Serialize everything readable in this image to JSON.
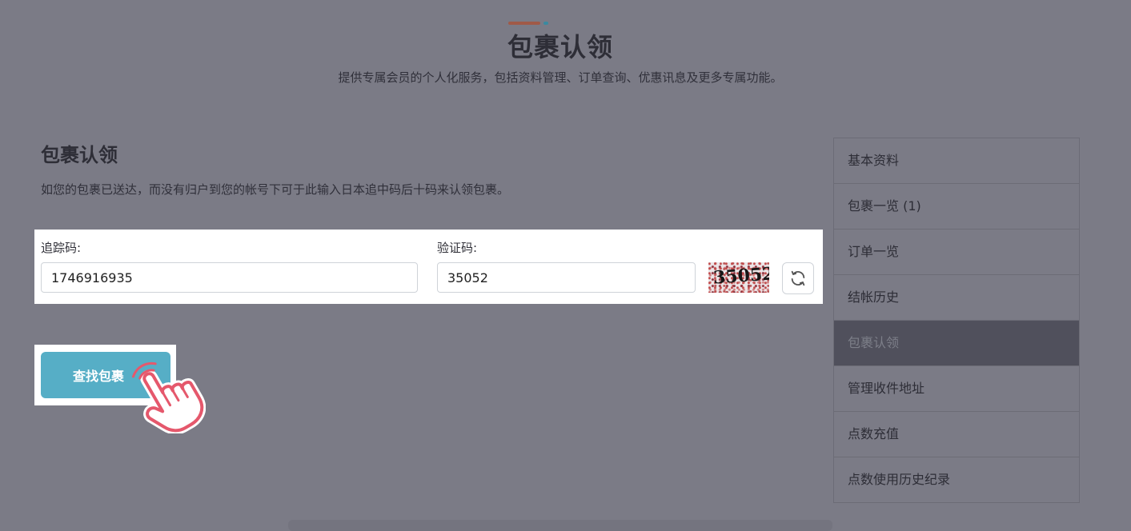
{
  "header": {
    "title": "包裹认领",
    "subtitle": "提供专属会员的个人化服务，包括资料管理、订单查询、优惠讯息及更多专属功能。",
    "accent_colors": [
      "#a05a48",
      "#3b8aa0"
    ]
  },
  "main": {
    "section_title": "包裹认领",
    "description": "如您的包裹已送达，而没有归户到您的帐号下可于此输入日本追中码后十码来认领包裹。",
    "form": {
      "tracking_label": "追踪码:",
      "tracking_value": "1746916935",
      "captcha_label": "验证码:",
      "captcha_value": "35052",
      "captcha_image_text": "35052",
      "refresh_icon": "refresh-icon"
    },
    "search_button_label": "查找包裹",
    "button_color": "#56aec6",
    "pointer_icon": "hand-pointer-icon"
  },
  "sidebar": {
    "items": [
      {
        "label": "基本资料",
        "active": false
      },
      {
        "label": "包裹一览 (1)",
        "active": false
      },
      {
        "label": "订单一览",
        "active": false
      },
      {
        "label": "结帐历史",
        "active": false
      },
      {
        "label": "包裹认领",
        "active": true
      },
      {
        "label": "管理收件地址",
        "active": false
      },
      {
        "label": "点数充值",
        "active": false
      },
      {
        "label": "点数使用历史纪录",
        "active": false
      }
    ]
  }
}
